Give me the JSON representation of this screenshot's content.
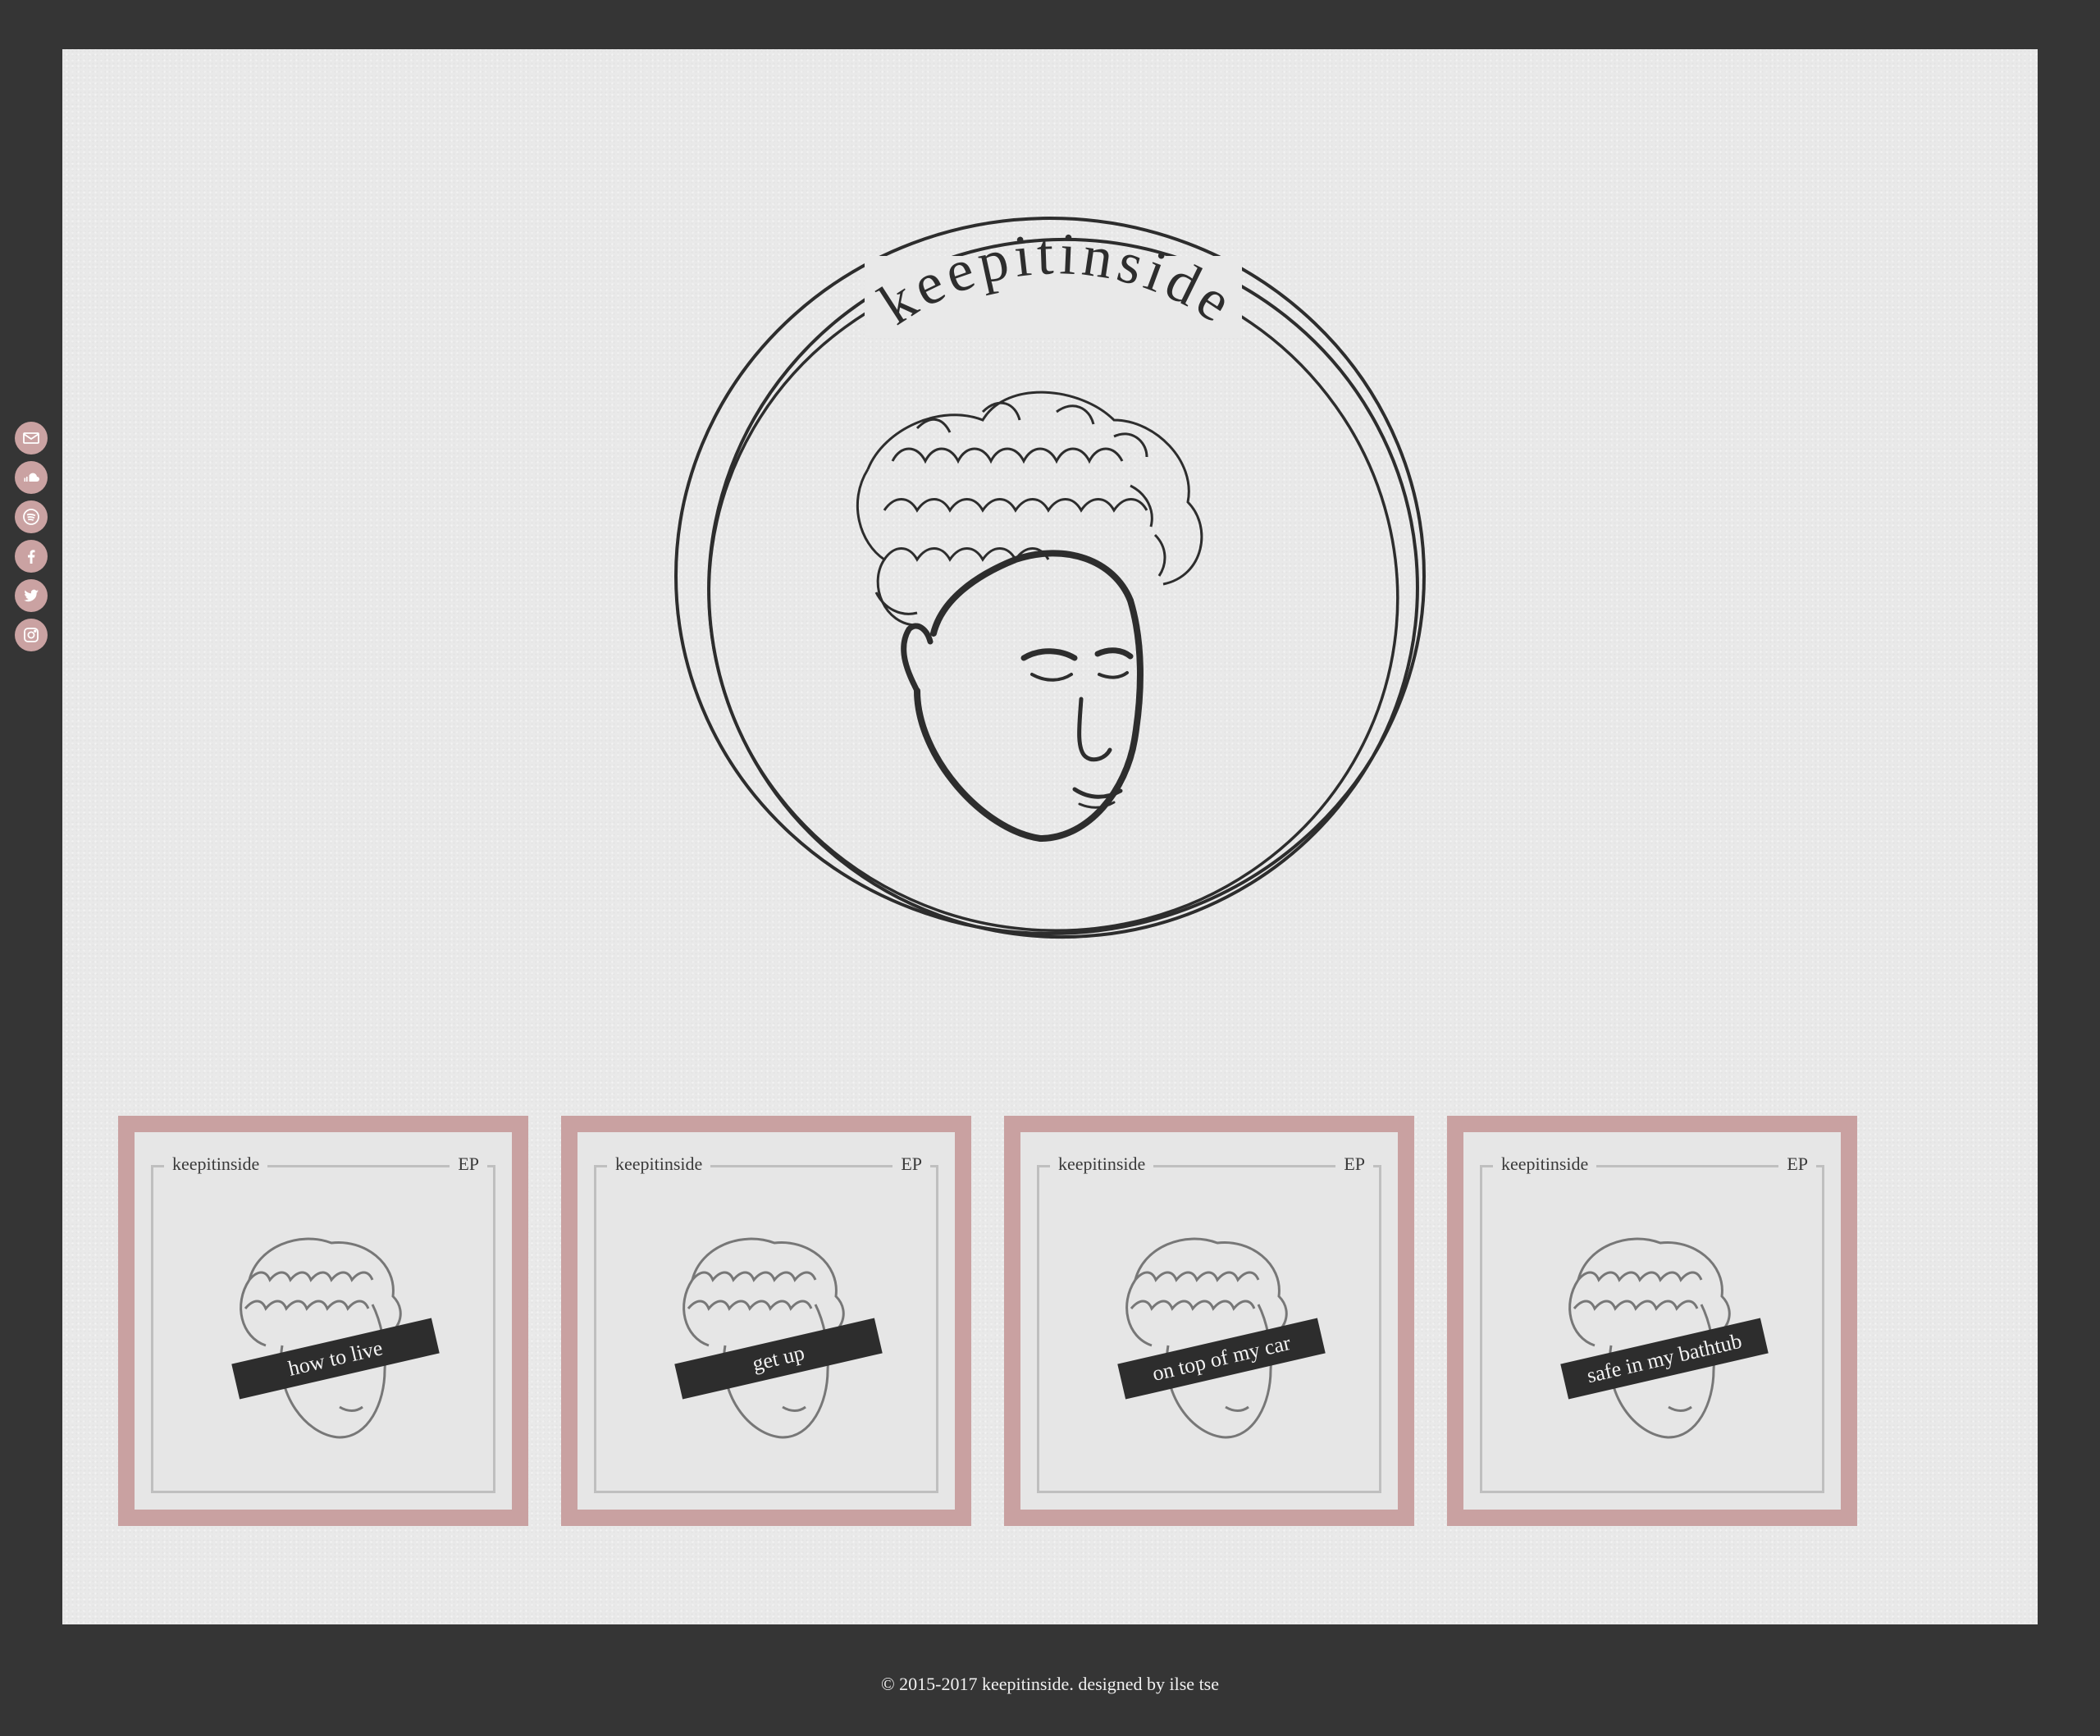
{
  "colors": {
    "page_bg": "#353535",
    "paper": "#e9e9e9",
    "accent_pink": "#caa2a2",
    "ink": "#2d2d2d"
  },
  "social": [
    {
      "name": "mail-icon"
    },
    {
      "name": "soundcloud-icon"
    },
    {
      "name": "spotify-icon"
    },
    {
      "name": "facebook-icon"
    },
    {
      "name": "twitter-icon"
    },
    {
      "name": "instagram-icon"
    }
  ],
  "hero": {
    "wordmark": "keepitinside"
  },
  "releases": [
    {
      "artist": "keepitinside",
      "type": "EP",
      "title": "how to live"
    },
    {
      "artist": "keepitinside",
      "type": "EP",
      "title": "get up"
    },
    {
      "artist": "keepitinside",
      "type": "EP",
      "title": "on top of my car"
    },
    {
      "artist": "keepitinside",
      "type": "EP",
      "title": "safe in my bathtub"
    }
  ],
  "footer": {
    "text": "© 2015-2017 keepitinside. designed by ilse tse"
  }
}
